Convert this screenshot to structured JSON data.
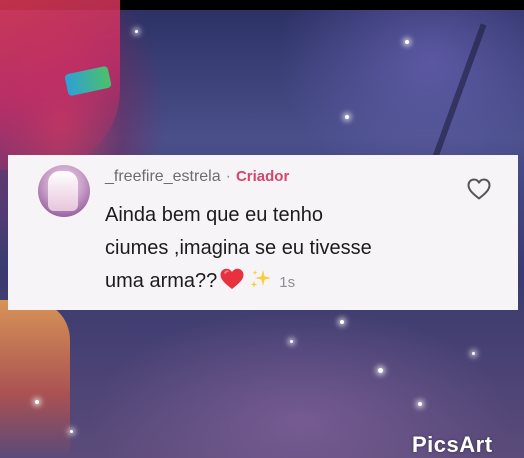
{
  "comment": {
    "username": "_freefire_estrela",
    "separator": "·",
    "badge": "Criador",
    "lines": [
      "Ainda bem que eu tenho",
      "ciumes ,imagina se eu tivesse",
      "uma arma??"
    ],
    "time": "1s",
    "icons": {
      "like": "heart-outline-icon",
      "emoji_1": "red-heart-emoji",
      "emoji_2": "sparkles-emoji"
    }
  },
  "watermark": {
    "text": "PicsArt"
  },
  "colors": {
    "card_background": "#f7f4f7",
    "username": "#6d6d6d",
    "creator_badge": "#d4466a",
    "text": "#1c1c1c",
    "time": "#8e8e8e",
    "heart_emoji": "#e8313f"
  }
}
